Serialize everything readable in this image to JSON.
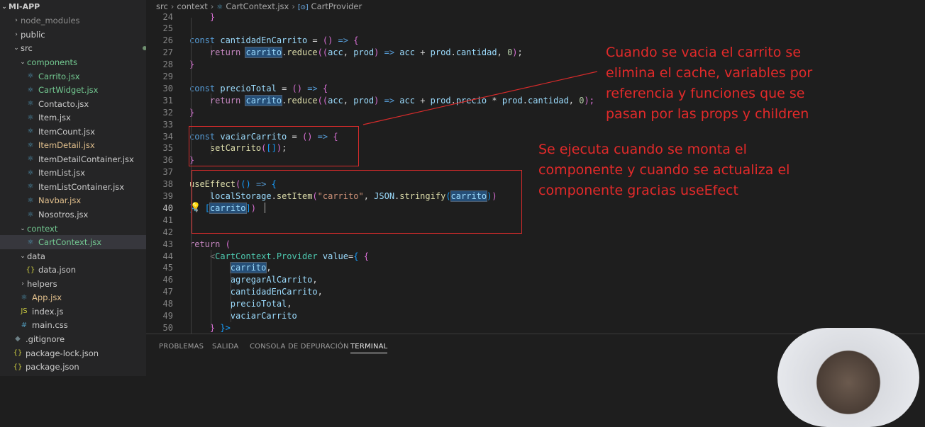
{
  "sidebar": {
    "title": "MI-APP",
    "items": [
      {
        "label": "node_modules",
        "kind": "folder-closed",
        "color": "#8b8b8b"
      },
      {
        "label": "public",
        "kind": "folder-closed",
        "color": "#cccccc"
      },
      {
        "label": "src",
        "kind": "folder-open",
        "color": "#cccccc",
        "status": "dot"
      },
      {
        "label": "components",
        "kind": "folder-open",
        "color": "#73c991",
        "status": "dot"
      },
      {
        "label": "Carrito.jsx",
        "kind": "react",
        "color": "#73c991",
        "status": "U"
      },
      {
        "label": "CartWidget.jsx",
        "kind": "react",
        "color": "#73c991",
        "status": "U"
      },
      {
        "label": "Contacto.jsx",
        "kind": "react",
        "color": "#cccccc"
      },
      {
        "label": "Item.jsx",
        "kind": "react",
        "color": "#cccccc"
      },
      {
        "label": "ItemCount.jsx",
        "kind": "react",
        "color": "#cccccc"
      },
      {
        "label": "ItemDetail.jsx",
        "kind": "react",
        "color": "#e2c08d",
        "status": "M"
      },
      {
        "label": "ItemDetailContainer.jsx",
        "kind": "react",
        "color": "#cccccc"
      },
      {
        "label": "ItemList.jsx",
        "kind": "react",
        "color": "#cccccc"
      },
      {
        "label": "ItemListContainer.jsx",
        "kind": "react",
        "color": "#cccccc"
      },
      {
        "label": "Navbar.jsx",
        "kind": "react",
        "color": "#e2c08d",
        "status": "M"
      },
      {
        "label": "Nosotros.jsx",
        "kind": "react",
        "color": "#cccccc"
      },
      {
        "label": "context",
        "kind": "folder-open",
        "color": "#73c991",
        "status": "dot"
      },
      {
        "label": "CartContext.jsx",
        "kind": "react",
        "color": "#73c991",
        "status": "U",
        "selected": true
      },
      {
        "label": "data",
        "kind": "folder-open",
        "color": "#cccccc"
      },
      {
        "label": "data.json",
        "kind": "json",
        "color": "#cccccc"
      },
      {
        "label": "helpers",
        "kind": "folder-closed",
        "color": "#cccccc"
      },
      {
        "label": "App.jsx",
        "kind": "react",
        "color": "#e2c08d",
        "status": "M"
      },
      {
        "label": "index.js",
        "kind": "js",
        "color": "#cccccc"
      },
      {
        "label": "main.css",
        "kind": "css",
        "color": "#cccccc"
      },
      {
        "label": ".gitignore",
        "kind": "git",
        "color": "#cccccc"
      },
      {
        "label": "package-lock.json",
        "kind": "json",
        "color": "#cccccc"
      },
      {
        "label": "package.json",
        "kind": "json",
        "color": "#cccccc"
      }
    ],
    "status_colors": {
      "U": "#73c991",
      "M": "#e2c08d"
    }
  },
  "breadcrumb": {
    "seg1": "src",
    "seg2": "context",
    "seg3": "CartContext.jsx",
    "seg4": "CartProvider",
    "icon_react": "react-icon",
    "icon_symbol": "symbol-icon"
  },
  "code": {
    "active_line": 40,
    "lines": [
      {
        "n": 24,
        "indent": 0,
        "tokens": [
          [
            "    }",
            "brk"
          ]
        ]
      },
      {
        "n": 25,
        "indent": 0,
        "tokens": []
      },
      {
        "n": 26,
        "indent": 1,
        "tokens": [
          [
            "const ",
            "kw"
          ],
          [
            "cantidadEnCarrito",
            "var"
          ],
          [
            " = ",
            "op"
          ],
          [
            "()",
            "brk"
          ],
          [
            " => ",
            "kw"
          ],
          [
            "{",
            "brk"
          ]
        ]
      },
      {
        "n": 27,
        "indent": 2,
        "tokens": [
          [
            "return ",
            "ctrl"
          ],
          [
            "carrito",
            "varhl"
          ],
          [
            ".",
            "op"
          ],
          [
            "reduce",
            "fn"
          ],
          [
            "((",
            "brk"
          ],
          [
            "acc",
            "var"
          ],
          [
            ", ",
            "op"
          ],
          [
            "prod",
            "var"
          ],
          [
            ")",
            "brk"
          ],
          [
            " => ",
            "kw"
          ],
          [
            "acc",
            "var"
          ],
          [
            " + ",
            "op"
          ],
          [
            "prod",
            "var"
          ],
          [
            ".",
            "op"
          ],
          [
            "cantidad",
            "var"
          ],
          [
            ", ",
            "op"
          ],
          [
            "0",
            "num"
          ],
          [
            ")",
            "brk"
          ],
          [
            ";",
            "op"
          ]
        ]
      },
      {
        "n": 28,
        "indent": 1,
        "tokens": [
          [
            "}",
            "brk"
          ]
        ]
      },
      {
        "n": 29,
        "indent": 0,
        "tokens": []
      },
      {
        "n": 30,
        "indent": 1,
        "tokens": [
          [
            "const ",
            "kw"
          ],
          [
            "precioTotal",
            "var"
          ],
          [
            " = ",
            "op"
          ],
          [
            "()",
            "brk"
          ],
          [
            " => ",
            "kw"
          ],
          [
            "{",
            "brk"
          ]
        ]
      },
      {
        "n": 31,
        "indent": 2,
        "tokens": [
          [
            "return ",
            "ctrl"
          ],
          [
            "carrito",
            "varhl"
          ],
          [
            ".",
            "op"
          ],
          [
            "reduce",
            "fn"
          ],
          [
            "((",
            "brk"
          ],
          [
            "acc",
            "var"
          ],
          [
            ", ",
            "op"
          ],
          [
            "prod",
            "var"
          ],
          [
            ")",
            "brk"
          ],
          [
            " => ",
            "kw"
          ],
          [
            "acc",
            "var"
          ],
          [
            " + ",
            "op"
          ],
          [
            "prod",
            "var"
          ],
          [
            ".",
            "op"
          ],
          [
            "precio",
            "var"
          ],
          [
            " * ",
            "op"
          ],
          [
            "prod",
            "var"
          ],
          [
            ".",
            "op"
          ],
          [
            "cantidad",
            "var"
          ],
          [
            ", ",
            "op"
          ],
          [
            "0",
            "num"
          ],
          [
            ");",
            "brk"
          ]
        ]
      },
      {
        "n": 32,
        "indent": 1,
        "tokens": [
          [
            "}",
            "brk"
          ]
        ]
      },
      {
        "n": 33,
        "indent": 0,
        "tokens": []
      },
      {
        "n": 34,
        "indent": 1,
        "tokens": [
          [
            "const ",
            "kw"
          ],
          [
            "vaciarCarrito",
            "var"
          ],
          [
            " = ",
            "op"
          ],
          [
            "()",
            "brk"
          ],
          [
            " => ",
            "kw"
          ],
          [
            "{",
            "brk"
          ]
        ]
      },
      {
        "n": 35,
        "indent": 2,
        "tokens": [
          [
            "setCarrito",
            "fn"
          ],
          [
            "(",
            "brk"
          ],
          [
            "[]",
            "brk2"
          ],
          [
            ")",
            "brk"
          ],
          [
            ";",
            "op"
          ]
        ]
      },
      {
        "n": 36,
        "indent": 1,
        "tokens": [
          [
            "}",
            "brk"
          ]
        ]
      },
      {
        "n": 37,
        "indent": 0,
        "tokens": []
      },
      {
        "n": 38,
        "indent": 1,
        "tokens": [
          [
            "useEffect",
            "fn"
          ],
          [
            "(",
            "brk"
          ],
          [
            "()",
            "brk2"
          ],
          [
            " => ",
            "kw"
          ],
          [
            "{",
            "brk2"
          ]
        ]
      },
      {
        "n": 39,
        "indent": 2,
        "tokens": [
          [
            "localStorage",
            "var"
          ],
          [
            ".",
            "op"
          ],
          [
            "setItem",
            "fn"
          ],
          [
            "(",
            "brk"
          ],
          [
            "\"carrito\"",
            "str"
          ],
          [
            ", ",
            "op"
          ],
          [
            "JSON",
            "var"
          ],
          [
            ".",
            "op"
          ],
          [
            "stringify",
            "fn"
          ],
          [
            "(",
            "brk2"
          ],
          [
            "carrito",
            "varhl"
          ],
          [
            ")",
            "brk2"
          ],
          [
            ")",
            "brk"
          ]
        ]
      },
      {
        "n": 40,
        "indent": 1,
        "tokens": [
          [
            "}",
            "brk2"
          ],
          [
            ", ",
            "op"
          ],
          [
            "[",
            "brk2"
          ],
          [
            "carrito",
            "varhl"
          ],
          [
            "]",
            "brk2"
          ],
          [
            ")",
            "brk"
          ]
        ]
      },
      {
        "n": 41,
        "indent": 0,
        "tokens": []
      },
      {
        "n": 42,
        "indent": 0,
        "tokens": []
      },
      {
        "n": 43,
        "indent": 1,
        "tokens": [
          [
            "return ",
            "ctrl"
          ],
          [
            "(",
            "brk"
          ]
        ]
      },
      {
        "n": 44,
        "indent": 2,
        "tokens": [
          [
            "<",
            "tag"
          ],
          [
            "CartContext.Provider",
            "comp"
          ],
          [
            " value",
            "attr"
          ],
          [
            "=",
            "op"
          ],
          [
            "{ ",
            "brk2"
          ],
          [
            "{",
            "brk"
          ]
        ]
      },
      {
        "n": 45,
        "indent": 3,
        "tokens": [
          [
            "carrito",
            "varhl"
          ],
          [
            ",",
            "op"
          ]
        ]
      },
      {
        "n": 46,
        "indent": 3,
        "tokens": [
          [
            "agregarAlCarrito",
            "var"
          ],
          [
            ",",
            "op"
          ]
        ]
      },
      {
        "n": 47,
        "indent": 3,
        "tokens": [
          [
            "cantidadEnCarrito",
            "var"
          ],
          [
            ",",
            "op"
          ]
        ]
      },
      {
        "n": 48,
        "indent": 3,
        "tokens": [
          [
            "precioTotal",
            "var"
          ],
          [
            ",",
            "op"
          ]
        ]
      },
      {
        "n": 49,
        "indent": 3,
        "tokens": [
          [
            "vaciarCarrito",
            "var"
          ]
        ]
      },
      {
        "n": 50,
        "indent": 2,
        "tokens": [
          [
            "} ",
            "brk"
          ],
          [
            "}>",
            "brk2"
          ]
        ]
      }
    ],
    "token_colors": {
      "kw": "#569cd6",
      "var": "#9cdcfe",
      "varhl": "#9cdcfe",
      "op": "#d4d4d4",
      "brk": "#da70d6",
      "brk2": "#179fff",
      "fn": "#dcdcaa",
      "ctrl": "#c586c0",
      "num": "#b5cea8",
      "str": "#ce9178",
      "tag": "#808080",
      "comp": "#4ec9b0",
      "attr": "#9cdcfe"
    }
  },
  "annotations": {
    "top": [
      "Cuando se vacia el carrito se",
      "elimina el cache, variables por",
      "referencia y funciones que se",
      "pasan por las props y children"
    ],
    "bottom": [
      "Se ejecuta cuando se monta el",
      "componente y cuando se actualiza el",
      "componente gracias useEfect"
    ],
    "color": "#e22a2a"
  },
  "panel": {
    "tabs": [
      "PROBLEMAS",
      "SALIDA",
      "CONSOLA DE DEPURACIÓN",
      "TERMINAL"
    ],
    "active_tab": "TERMINAL"
  },
  "icons": {
    "lightbulb": "lightbulb-icon",
    "chevron": "chevron-icon"
  }
}
